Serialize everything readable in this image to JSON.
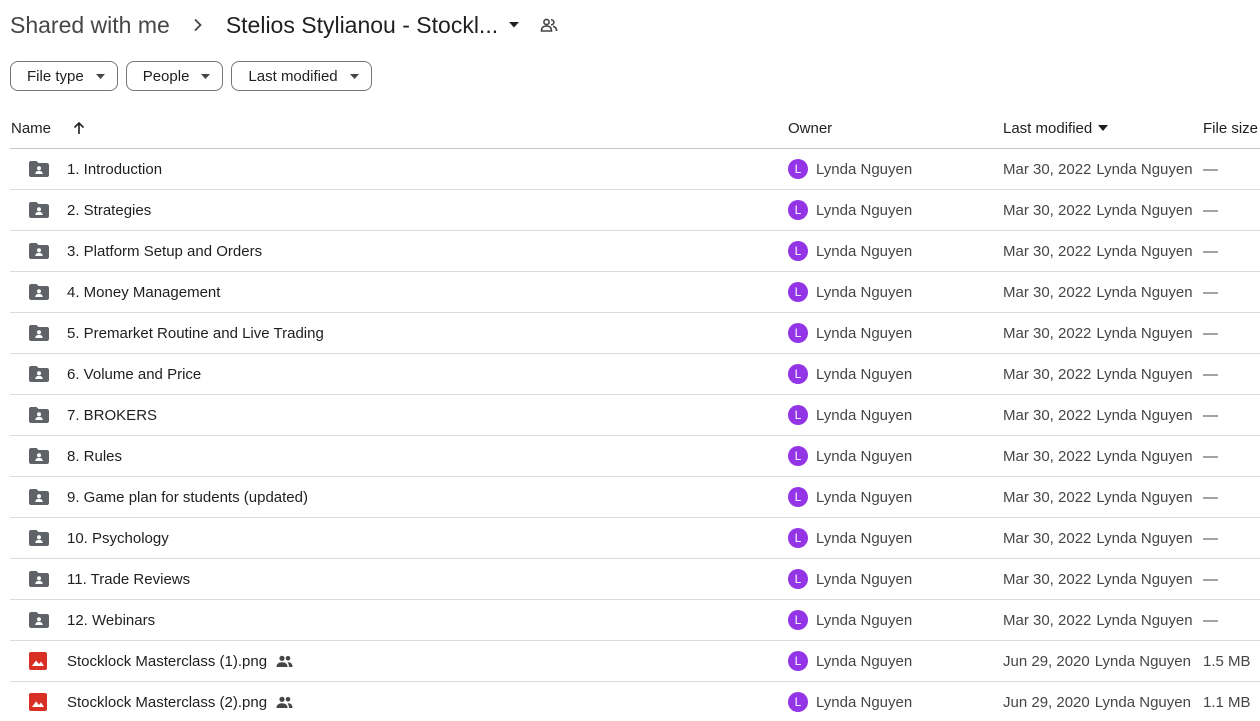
{
  "breadcrumb": {
    "root": "Shared with me",
    "current": "Stelios Stylianou - Stockl..."
  },
  "filters": [
    {
      "label": "File type"
    },
    {
      "label": "People"
    },
    {
      "label": "Last modified"
    }
  ],
  "columns": {
    "name": "Name",
    "owner": "Owner",
    "modified": "Last modified",
    "size": "File size"
  },
  "colors": {
    "avatar": "#9334e6",
    "folder": "#5f6368",
    "image": "#d93025"
  },
  "rows": [
    {
      "type": "folder-icon",
      "name": "1. Introduction",
      "avatar": "L",
      "owner": "Lynda Nguyen",
      "modified": "Mar 30, 2022",
      "by": "Lynda Nguyen",
      "size": "—",
      "shared": false
    },
    {
      "type": "folder-icon",
      "name": "2. Strategies",
      "avatar": "L",
      "owner": "Lynda Nguyen",
      "modified": "Mar 30, 2022",
      "by": "Lynda Nguyen",
      "size": "—",
      "shared": false
    },
    {
      "type": "folder-icon",
      "name": "3. Platform Setup and Orders",
      "avatar": "L",
      "owner": "Lynda Nguyen",
      "modified": "Mar 30, 2022",
      "by": "Lynda Nguyen",
      "size": "—",
      "shared": false
    },
    {
      "type": "folder-icon",
      "name": "4. Money Management",
      "avatar": "L",
      "owner": "Lynda Nguyen",
      "modified": "Mar 30, 2022",
      "by": "Lynda Nguyen",
      "size": "—",
      "shared": false
    },
    {
      "type": "folder-icon",
      "name": "5. Premarket Routine and Live Trading",
      "avatar": "L",
      "owner": "Lynda Nguyen",
      "modified": "Mar 30, 2022",
      "by": "Lynda Nguyen",
      "size": "—",
      "shared": false
    },
    {
      "type": "folder-icon",
      "name": "6. Volume and Price",
      "avatar": "L",
      "owner": "Lynda Nguyen",
      "modified": "Mar 30, 2022",
      "by": "Lynda Nguyen",
      "size": "—",
      "shared": false
    },
    {
      "type": "folder-icon",
      "name": "7. BROKERS",
      "avatar": "L",
      "owner": "Lynda Nguyen",
      "modified": "Mar 30, 2022",
      "by": "Lynda Nguyen",
      "size": "—",
      "shared": false
    },
    {
      "type": "folder-icon",
      "name": "8. Rules",
      "avatar": "L",
      "owner": "Lynda Nguyen",
      "modified": "Mar 30, 2022",
      "by": "Lynda Nguyen",
      "size": "—",
      "shared": false
    },
    {
      "type": "folder-icon",
      "name": "9. Game plan for students (updated)",
      "avatar": "L",
      "owner": "Lynda Nguyen",
      "modified": "Mar 30, 2022",
      "by": "Lynda Nguyen",
      "size": "—",
      "shared": false
    },
    {
      "type": "folder-icon",
      "name": "10. Psychology",
      "avatar": "L",
      "owner": "Lynda Nguyen",
      "modified": "Mar 30, 2022",
      "by": "Lynda Nguyen",
      "size": "—",
      "shared": false
    },
    {
      "type": "folder-icon",
      "name": "11. Trade Reviews",
      "avatar": "L",
      "owner": "Lynda Nguyen",
      "modified": "Mar 30, 2022",
      "by": "Lynda Nguyen",
      "size": "—",
      "shared": false
    },
    {
      "type": "folder-icon",
      "name": "12. Webinars",
      "avatar": "L",
      "owner": "Lynda Nguyen",
      "modified": "Mar 30, 2022",
      "by": "Lynda Nguyen",
      "size": "—",
      "shared": false
    },
    {
      "type": "image-file-icon",
      "name": "Stocklock Masterclass (1).png",
      "avatar": "L",
      "owner": "Lynda Nguyen",
      "modified": "Jun 29, 2020",
      "by": "Lynda Nguyen",
      "size": "1.5 MB",
      "shared": true
    },
    {
      "type": "image-file-icon",
      "name": "Stocklock Masterclass (2).png",
      "avatar": "L",
      "owner": "Lynda Nguyen",
      "modified": "Jun 29, 2020",
      "by": "Lynda Nguyen",
      "size": "1.1 MB",
      "shared": true
    }
  ]
}
